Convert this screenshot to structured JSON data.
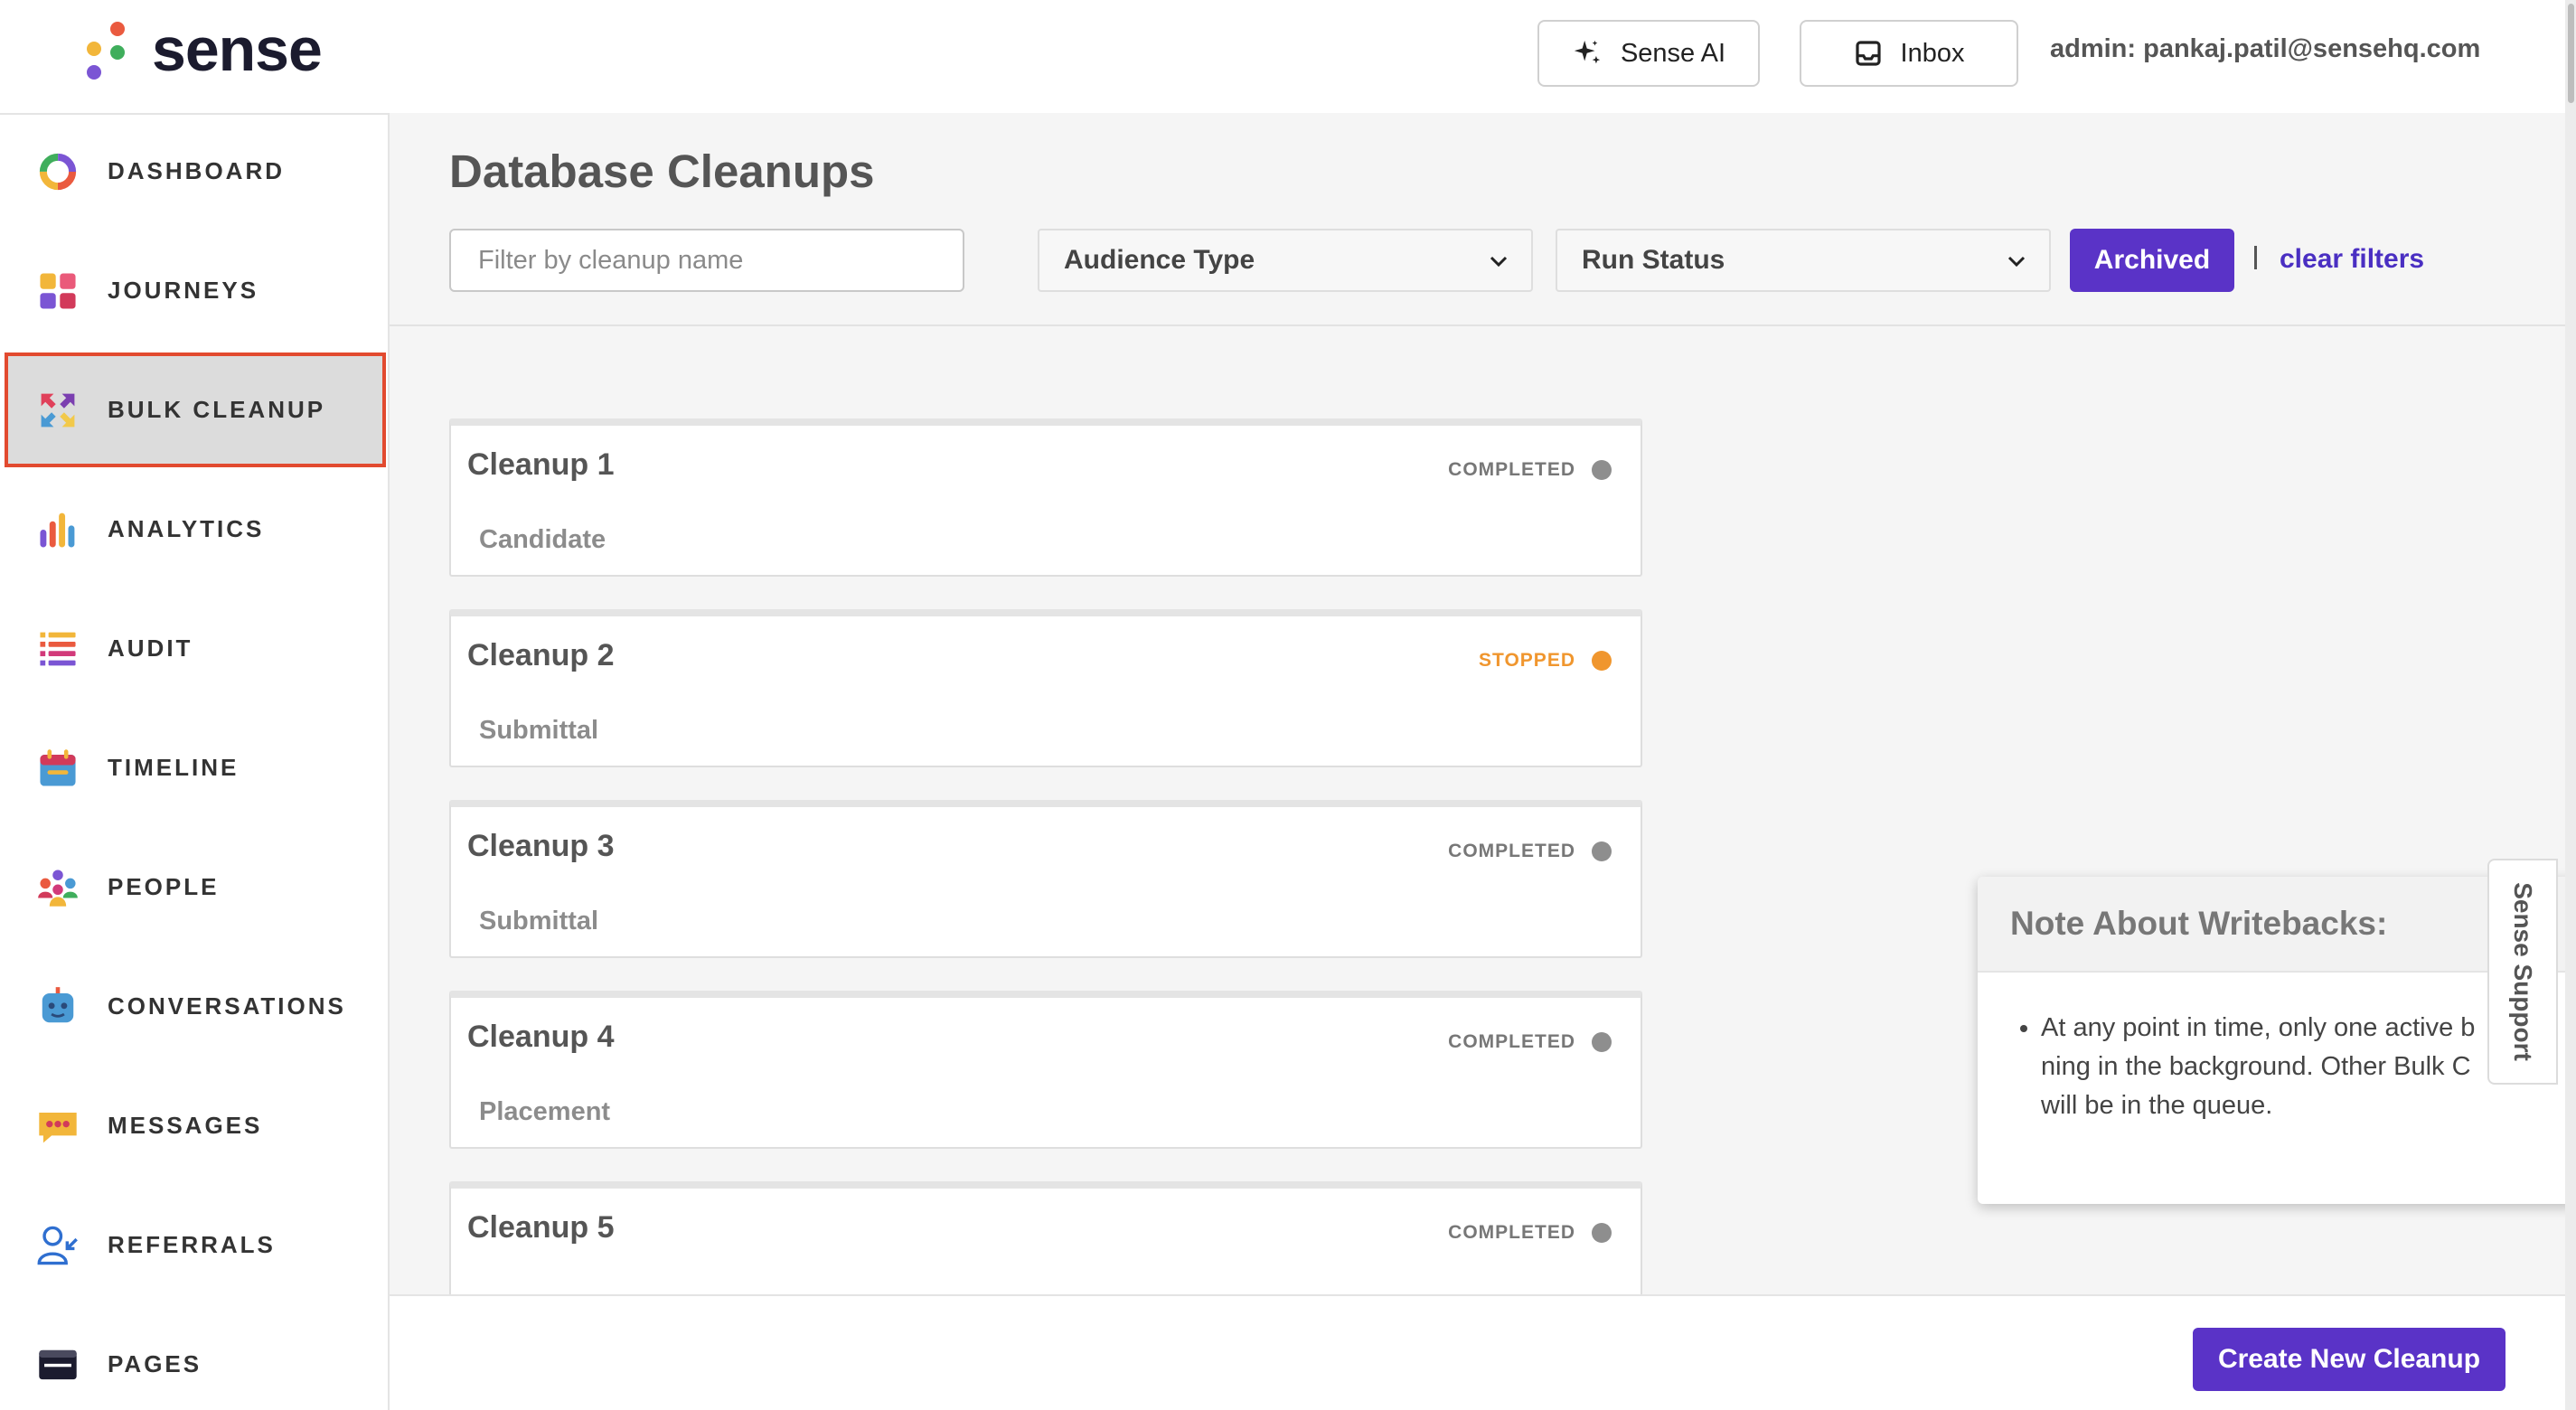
{
  "header": {
    "logo_text": "sense",
    "sense_ai_label": "Sense AI",
    "inbox_label": "Inbox",
    "admin_text": "admin: pankaj.patil@sensehq.com"
  },
  "sidebar": {
    "items": [
      {
        "label": "DASHBOARD",
        "icon": "dashboard-icon",
        "active": false
      },
      {
        "label": "JOURNEYS",
        "icon": "journeys-icon",
        "active": false
      },
      {
        "label": "BULK CLEANUP",
        "icon": "bulk-cleanup-icon",
        "active": true
      },
      {
        "label": "ANALYTICS",
        "icon": "analytics-icon",
        "active": false
      },
      {
        "label": "AUDIT",
        "icon": "audit-icon",
        "active": false
      },
      {
        "label": "TIMELINE",
        "icon": "timeline-icon",
        "active": false
      },
      {
        "label": "PEOPLE",
        "icon": "people-icon",
        "active": false
      },
      {
        "label": "CONVERSATIONS",
        "icon": "conversations-icon",
        "active": false
      },
      {
        "label": "MESSAGES",
        "icon": "messages-icon",
        "active": false
      },
      {
        "label": "REFERRALS",
        "icon": "referrals-icon",
        "active": false
      },
      {
        "label": "PAGES",
        "icon": "pages-icon",
        "active": false
      }
    ]
  },
  "main": {
    "title": "Database Cleanups",
    "filter_placeholder": "Filter by cleanup name",
    "audience_select": "Audience Type",
    "run_status_select": "Run Status",
    "archived_label": "Archived",
    "clear_filters_label": "clear filters",
    "cards": [
      {
        "title": "Cleanup 1",
        "status": "COMPLETED",
        "status_color": "#8e8e8e",
        "audience": "Candidate"
      },
      {
        "title": "Cleanup 2",
        "status": "STOPPED",
        "status_color": "#f0962e",
        "audience": "Submittal"
      },
      {
        "title": "Cleanup 3",
        "status": "COMPLETED",
        "status_color": "#8e8e8e",
        "audience": "Submittal"
      },
      {
        "title": "Cleanup 4",
        "status": "COMPLETED",
        "status_color": "#8e8e8e",
        "audience": "Placement"
      },
      {
        "title": "Cleanup 5",
        "status": "COMPLETED",
        "status_color": "#8e8e8e",
        "audience": ""
      }
    ]
  },
  "note": {
    "title": "Note About Writebacks:",
    "line1": "At any point in time, only one active b",
    "line2": "ning in the background. Other Bulk C",
    "line3": "will be in the queue."
  },
  "support": {
    "label": "Sense Support"
  },
  "footer": {
    "create_label": "Create New Cleanup"
  },
  "colors": {
    "accent": "#5a33c7",
    "link": "#4a2fc2",
    "active_outline": "#e24a2f",
    "stopped": "#f0962e",
    "completed": "#8e8e8e"
  }
}
